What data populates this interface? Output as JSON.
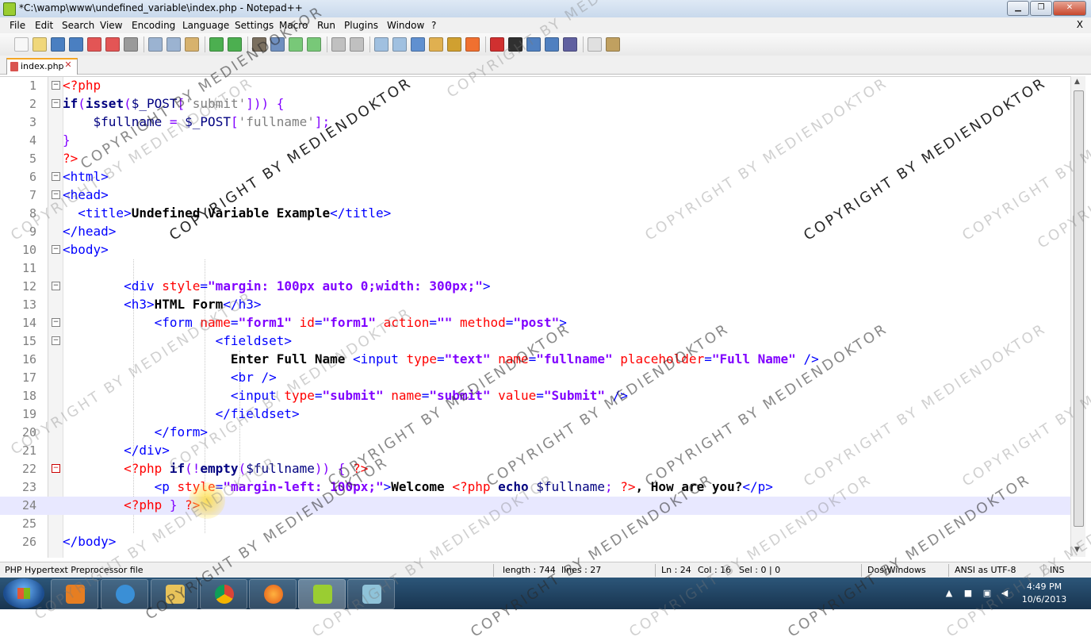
{
  "window": {
    "title": "*C:\\wamp\\www\\undefined_variable\\index.php - Notepad++",
    "min": "▁",
    "max": "❐",
    "close": "✕"
  },
  "menu": [
    "File",
    "Edit",
    "Search",
    "View",
    "Encoding",
    "Language",
    "Settings",
    "Macro",
    "Run",
    "Plugins",
    "Window",
    "?"
  ],
  "menu_close": "X",
  "tab": {
    "label": "index.php",
    "close": "✕"
  },
  "toolbar_icons": [
    "new-file-icon",
    "open-file-icon",
    "save-icon",
    "save-all-icon",
    "close-icon",
    "close-all-icon",
    "print-icon",
    "cut-icon",
    "copy-icon",
    "paste-icon",
    "undo-icon",
    "redo-icon",
    "find-icon",
    "replace-icon",
    "zoom-in-icon",
    "zoom-out-icon",
    "sync-v-icon",
    "sync-h-icon",
    "wrap-icon",
    "all-chars-icon",
    "indent-guide-icon",
    "udl-icon",
    "doc-map-icon",
    "function-list-icon",
    "record-icon",
    "stop-icon",
    "play-icon",
    "run-multiple-icon",
    "save-macro-icon",
    "ds-icon",
    "plugin-icon"
  ],
  "editor": {
    "current_line": 24,
    "lines": [
      {
        "n": "1",
        "segs": [
          [
            "php",
            "<?php"
          ]
        ]
      },
      {
        "n": "2",
        "segs": [
          [
            "kw",
            "if"
          ],
          [
            "op",
            "("
          ],
          [
            "kw",
            "isset"
          ],
          [
            "op",
            "("
          ],
          [
            "var",
            "$_POST"
          ],
          [
            "op",
            "["
          ],
          [
            "str",
            "'submit'"
          ],
          [
            "op",
            "]))"
          ],
          [
            "text",
            " "
          ],
          [
            "op",
            "{"
          ]
        ]
      },
      {
        "n": "3",
        "segs": [
          [
            "var",
            "    $fullname"
          ],
          [
            "text",
            " "
          ],
          [
            "op",
            "="
          ],
          [
            "text",
            " "
          ],
          [
            "var",
            "$_POST"
          ],
          [
            "op",
            "["
          ],
          [
            "str",
            "'fullname'"
          ],
          [
            "op",
            "];"
          ]
        ]
      },
      {
        "n": "4",
        "segs": [
          [
            "op",
            "}"
          ]
        ]
      },
      {
        "n": "5",
        "segs": [
          [
            "php",
            "?>"
          ]
        ]
      },
      {
        "n": "6",
        "segs": [
          [
            "tag",
            "<html>"
          ]
        ]
      },
      {
        "n": "7",
        "segs": [
          [
            "tag",
            "<head>"
          ]
        ]
      },
      {
        "n": "8",
        "segs": [
          [
            "tag",
            "  <title>"
          ],
          [
            "text",
            "Undefined Variable Example"
          ],
          [
            "tag",
            "</title>"
          ]
        ]
      },
      {
        "n": "9",
        "segs": [
          [
            "tag",
            "</head>"
          ]
        ]
      },
      {
        "n": "10",
        "segs": [
          [
            "tag",
            "<body>"
          ]
        ]
      },
      {
        "n": "11",
        "segs": []
      },
      {
        "n": "12",
        "segs": [
          [
            "tag",
            "        <div "
          ],
          [
            "attr",
            "style"
          ],
          [
            "tag",
            "="
          ],
          [
            "val",
            "\"margin: 100px auto 0;width: 300px;\""
          ],
          [
            "tag",
            ">"
          ]
        ]
      },
      {
        "n": "13",
        "segs": [
          [
            "tag",
            "        <h3>"
          ],
          [
            "text",
            "HTML Form"
          ],
          [
            "tag",
            "</h3>"
          ]
        ]
      },
      {
        "n": "14",
        "segs": [
          [
            "tag",
            "            <form "
          ],
          [
            "attr",
            "name"
          ],
          [
            "tag",
            "="
          ],
          [
            "val",
            "\"form1\""
          ],
          [
            "tag",
            " "
          ],
          [
            "attr",
            "id"
          ],
          [
            "tag",
            "="
          ],
          [
            "val",
            "\"form1\""
          ],
          [
            "tag",
            " "
          ],
          [
            "attr",
            "action"
          ],
          [
            "tag",
            "="
          ],
          [
            "val",
            "\"\""
          ],
          [
            "tag",
            " "
          ],
          [
            "attr",
            "method"
          ],
          [
            "tag",
            "="
          ],
          [
            "val",
            "\"post\""
          ],
          [
            "tag",
            ">"
          ]
        ]
      },
      {
        "n": "15",
        "segs": [
          [
            "tag",
            "                    <fieldset>"
          ]
        ]
      },
      {
        "n": "16",
        "segs": [
          [
            "text",
            "                      Enter Full Name "
          ],
          [
            "tag",
            "<input "
          ],
          [
            "attr",
            "type"
          ],
          [
            "tag",
            "="
          ],
          [
            "val",
            "\"text\""
          ],
          [
            "tag",
            " "
          ],
          [
            "attr",
            "name"
          ],
          [
            "tag",
            "="
          ],
          [
            "val",
            "\"fullname\""
          ],
          [
            "tag",
            " "
          ],
          [
            "attr",
            "placeholder"
          ],
          [
            "tag",
            "="
          ],
          [
            "val",
            "\"Full Name\""
          ],
          [
            "tag",
            " />"
          ]
        ]
      },
      {
        "n": "17",
        "segs": [
          [
            "tag",
            "                      <br />"
          ]
        ]
      },
      {
        "n": "18",
        "segs": [
          [
            "tag",
            "                      <input "
          ],
          [
            "attr",
            "type"
          ],
          [
            "tag",
            "="
          ],
          [
            "val",
            "\"submit\""
          ],
          [
            "tag",
            " "
          ],
          [
            "attr",
            "name"
          ],
          [
            "tag",
            "="
          ],
          [
            "val",
            "\"submit\""
          ],
          [
            "tag",
            " "
          ],
          [
            "attr",
            "value"
          ],
          [
            "tag",
            "="
          ],
          [
            "val",
            "\"Submit\""
          ],
          [
            "tag",
            " />"
          ]
        ]
      },
      {
        "n": "19",
        "segs": [
          [
            "tag",
            "                    </fieldset>"
          ]
        ]
      },
      {
        "n": "20",
        "segs": [
          [
            "tag",
            "            </form>"
          ]
        ]
      },
      {
        "n": "21",
        "segs": [
          [
            "tag",
            "        </div>"
          ]
        ]
      },
      {
        "n": "22",
        "segs": [
          [
            "php",
            "        <?php "
          ],
          [
            "kw",
            "if"
          ],
          [
            "op",
            "(!"
          ],
          [
            "kw",
            "empty"
          ],
          [
            "op",
            "("
          ],
          [
            "var",
            "$fullname"
          ],
          [
            "op",
            ")) {"
          ],
          [
            "text",
            " "
          ],
          [
            "php",
            "?>"
          ]
        ]
      },
      {
        "n": "23",
        "segs": [
          [
            "tag",
            "            <p "
          ],
          [
            "attr",
            "style"
          ],
          [
            "tag",
            "="
          ],
          [
            "val",
            "\"margin-left: 100px;\""
          ],
          [
            "tag",
            ">"
          ],
          [
            "text",
            "Welcome "
          ],
          [
            "php",
            "<?php "
          ],
          [
            "kw",
            "echo"
          ],
          [
            "text",
            " "
          ],
          [
            "var",
            "$fullname"
          ],
          [
            "op",
            ";"
          ],
          [
            "text",
            " "
          ],
          [
            "php",
            "?>"
          ],
          [
            "text",
            ", How are you?"
          ],
          [
            "tag",
            "</p>"
          ]
        ]
      },
      {
        "n": "24",
        "segs": [
          [
            "php",
            "        <?php "
          ],
          [
            "op",
            "}"
          ],
          [
            "text",
            " "
          ],
          [
            "php",
            "?>"
          ]
        ]
      },
      {
        "n": "25",
        "segs": []
      },
      {
        "n": "26",
        "segs": [
          [
            "tag",
            "</body>"
          ]
        ]
      }
    ]
  },
  "status": {
    "filetype": "PHP Hypertext Preprocessor file",
    "length": "length : 744",
    "lines": "lines : 27",
    "ln": "Ln : 24",
    "col": "Col : 16",
    "sel": "Sel : 0 | 0",
    "eol": "Dos\\Windows",
    "encoding": "ANSI as UTF-8",
    "mode": "INS"
  },
  "clock": {
    "time": "4:49 PM",
    "date": "10/6/2013"
  },
  "watermark": "COPYRIGHT BY MEDIENDOKTOR",
  "colors": {
    "tag": "#0000ff",
    "attr": "#ff0000",
    "val": "#8000ff",
    "php": "#ff0000",
    "kw": "#000080",
    "current_line": "#e8e8ff"
  }
}
